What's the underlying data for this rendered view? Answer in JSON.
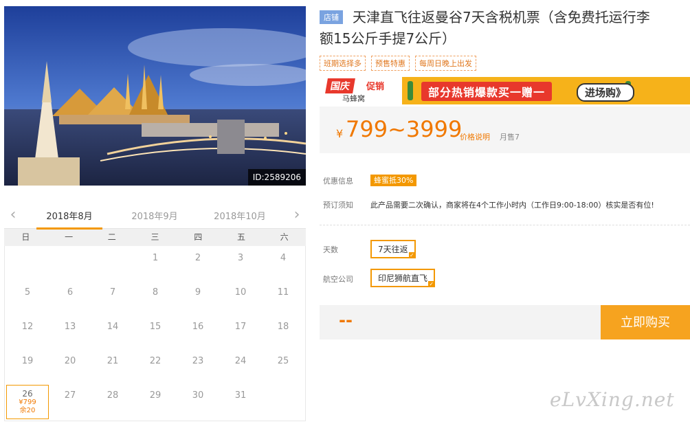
{
  "photo": {
    "id_label": "ID:2589206"
  },
  "calendar": {
    "tabs": [
      "2018年8月",
      "2018年9月",
      "2018年10月"
    ],
    "weekdays": [
      "日",
      "一",
      "二",
      "三",
      "四",
      "五",
      "六"
    ],
    "days": [
      "1",
      "2",
      "3",
      "4",
      "5",
      "6",
      "7",
      "8",
      "9",
      "10",
      "11",
      "12",
      "13",
      "14",
      "15",
      "16",
      "17",
      "18",
      "19",
      "20",
      "21",
      "22",
      "23",
      "24",
      "25",
      "26",
      "27",
      "28",
      "29",
      "30",
      "31"
    ],
    "selected_day": {
      "day": "26",
      "price": "¥799",
      "stock": "余20"
    }
  },
  "product": {
    "shop_tag": "店铺",
    "title_line1": "天津直飞往返曼谷7天含税机票（含免费托运行李",
    "title_line2": "额15公斤手提7公斤）",
    "tags": [
      "班期选择多",
      "预售特惠",
      "每周日晚上出发"
    ]
  },
  "banner": {
    "logo": "国庆",
    "logo2": "促销",
    "brand": "马蜂窝",
    "headline": "部分热销爆款买一赠一",
    "cta": "进场购》"
  },
  "price": {
    "currency": "¥",
    "range": "799~3999",
    "note": "价格说明",
    "sold": "月售7"
  },
  "info": {
    "promo_label": "优惠信息",
    "promo_value": "蜂蜜抵30%",
    "notice_label": "预订须知",
    "notice_value": "此产品需要二次确认，商家将在4个工作小时内（工作日9:00-18:00）核实是否有位!"
  },
  "options": {
    "days_label": "天数",
    "days_value": "7天往返",
    "airline_label": "航空公司",
    "airline_value": "印尼狮航直飞"
  },
  "buy": {
    "total": "--",
    "button": "立即购买"
  },
  "watermark": "eLvXing.net"
}
